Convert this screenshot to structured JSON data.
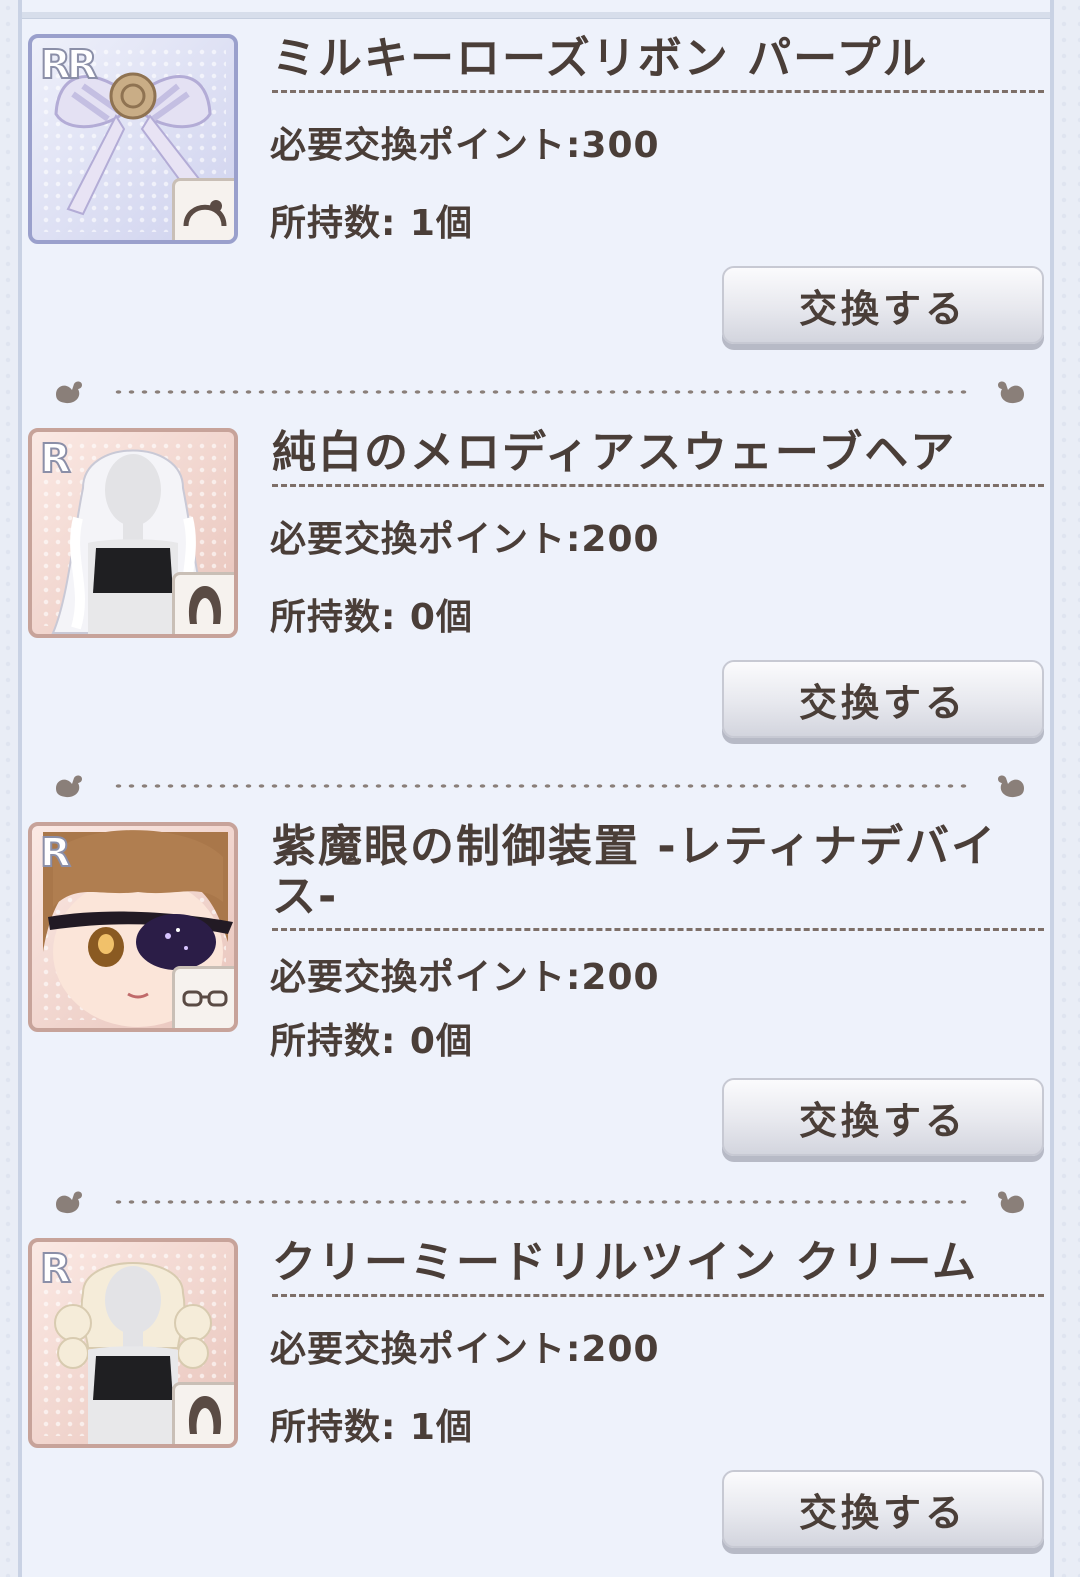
{
  "button_label": "交換する",
  "items": [
    {
      "rarity": "RR",
      "name": "ミルキーローズリボン パープル",
      "points": "必要交換ポイント:300",
      "owned": "所持数: 1個",
      "category_icon": "headband-icon"
    },
    {
      "rarity": "R",
      "name": "純白のメロディアスウェーブヘア",
      "points": "必要交換ポイント:200",
      "owned": "所持数: 0個",
      "category_icon": "hair-icon"
    },
    {
      "rarity": "R",
      "name": "紫魔眼の制御装置 -レティナデバイス-",
      "points": "必要交換ポイント:200",
      "owned": "所持数: 0個",
      "category_icon": "glasses-icon"
    },
    {
      "rarity": "R",
      "name": "クリーミードリルツイン クリーム",
      "points": "必要交換ポイント:200",
      "owned": "所持数: 1個",
      "category_icon": "hair-icon"
    }
  ],
  "colors": {
    "text": "#4a3e38",
    "panel": "#eef2fb",
    "rr_border": "#9aa0cc",
    "r_border": "#c7a39a"
  }
}
